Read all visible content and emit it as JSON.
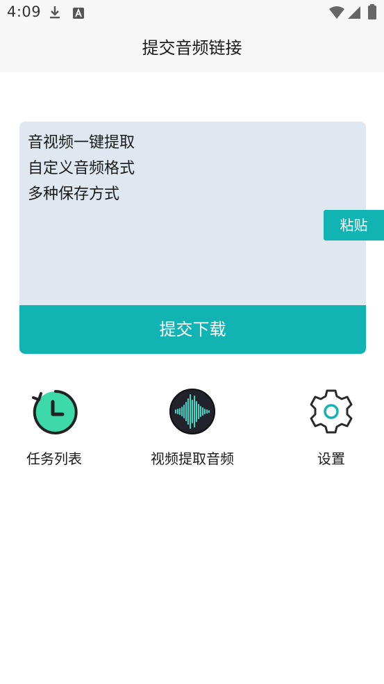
{
  "status_bar": {
    "time": "4:09",
    "icons": [
      "download-icon",
      "a-badge-icon",
      "wifi-icon",
      "signal-icon",
      "battery-icon"
    ]
  },
  "app_bar": {
    "title": "提交音频链接"
  },
  "link_input": {
    "lines": [
      "音视频一键提取",
      "自定义音频格式",
      "多种保存方式"
    ]
  },
  "buttons": {
    "paste": "粘贴",
    "submit": "提交下载"
  },
  "shortcuts": [
    {
      "label": "任务列表",
      "icon": "task-history-icon"
    },
    {
      "label": "视频提取音频",
      "icon": "audio-waveform-icon"
    },
    {
      "label": "设置",
      "icon": "settings-gear-icon"
    }
  ],
  "colors": {
    "accent": "#12b3b3",
    "card_bg": "#dfe8f1",
    "bar_bg": "#f7f7f7",
    "task_icon_green": "#3dd9a9",
    "wave_icon_dark": "#22232a"
  }
}
